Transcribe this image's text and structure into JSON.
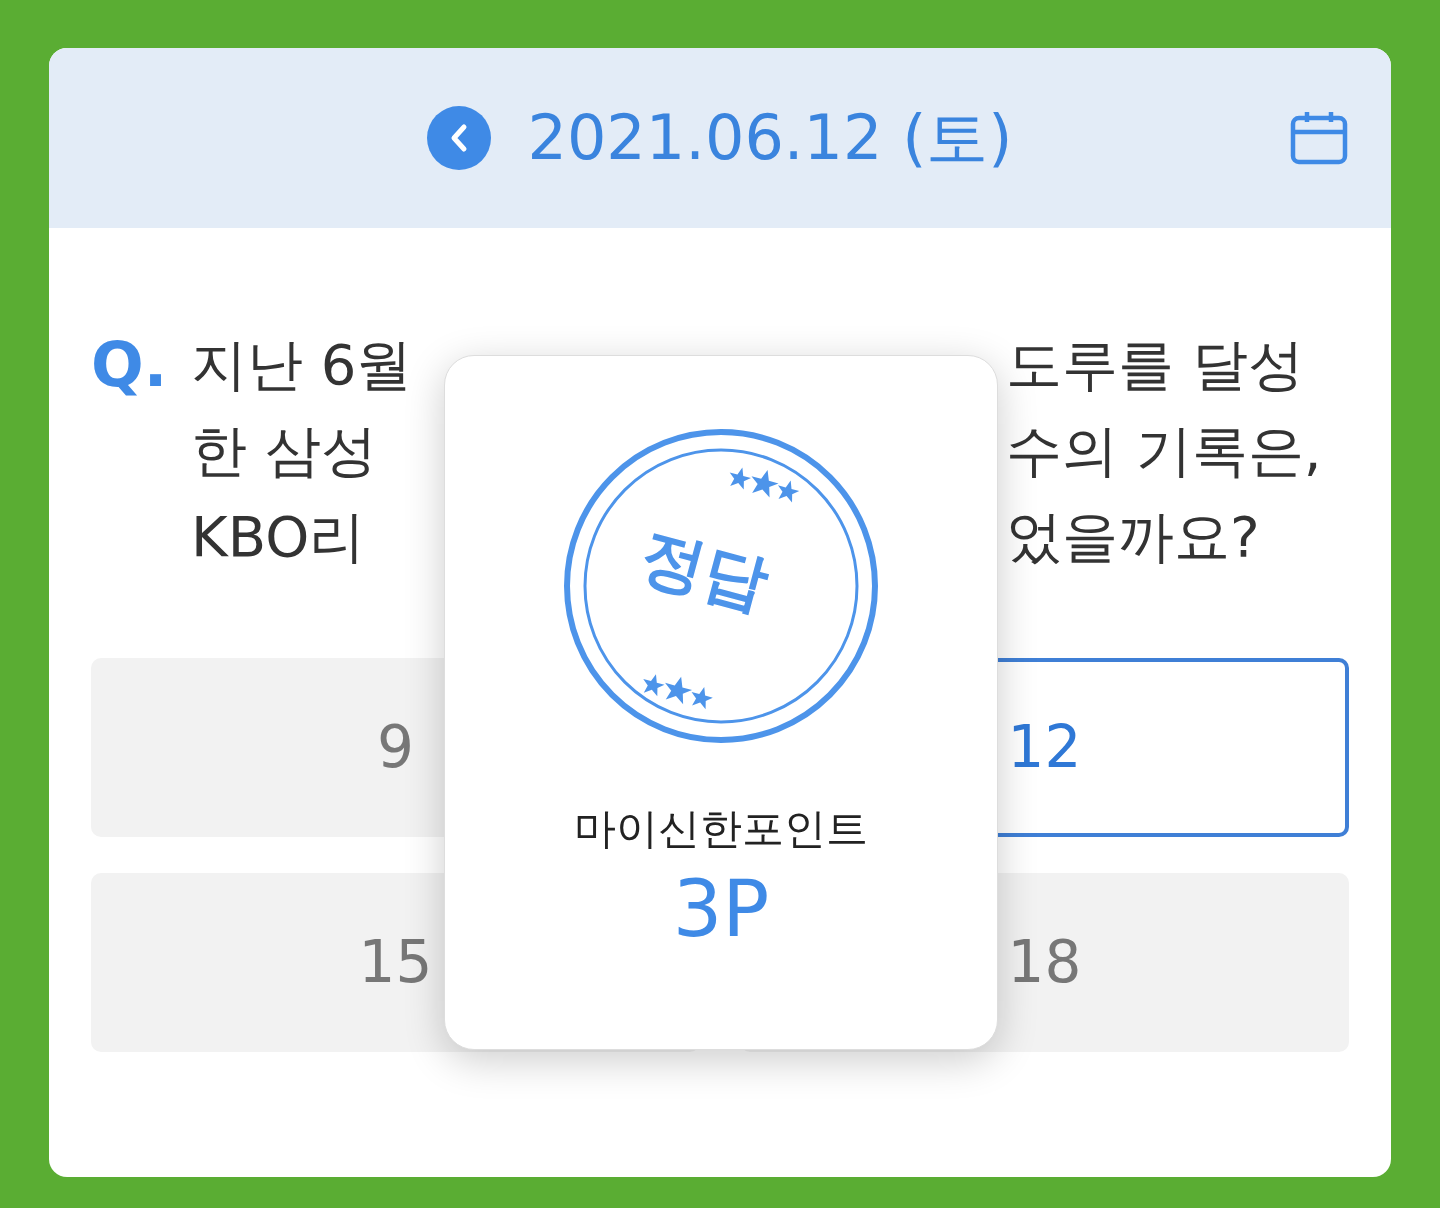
{
  "header": {
    "date": "2021.06.12 (토)"
  },
  "question": {
    "mark": "Q.",
    "lines": [
      {
        "left": "지난 6월",
        "right": "도루를 달성"
      },
      {
        "left": "한 삼성",
        "right": "수의 기록은,"
      },
      {
        "left": "KBO리",
        "right": "었을까요?"
      }
    ]
  },
  "options": [
    {
      "label": "9",
      "selected": false
    },
    {
      "label": "12",
      "selected": true
    },
    {
      "label": "15",
      "selected": false
    },
    {
      "label": "18",
      "selected": false
    }
  ],
  "popup": {
    "stamp": "정답",
    "title": "마이신한포인트",
    "points": "3P"
  }
}
